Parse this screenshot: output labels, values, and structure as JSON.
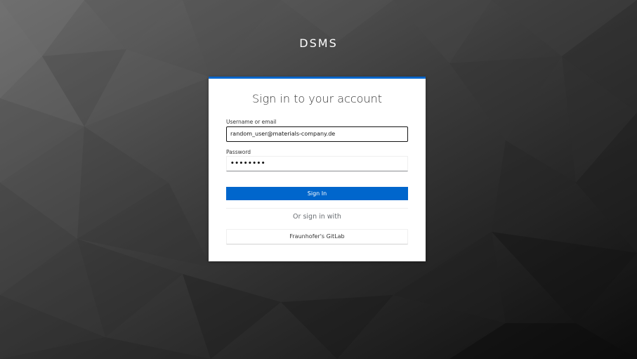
{
  "app": {
    "title": "DSMS"
  },
  "login": {
    "heading": "Sign in to your account",
    "username_label": "Username or email",
    "username_value": "random_user@materials-company.de",
    "password_label": "Password",
    "password_value": "••••••••",
    "signin_label": "Sign In",
    "alt_signin_text": "Or sign in with",
    "provider_label": "Fraunhofer's GitLab"
  },
  "colors": {
    "primary": "#0066cc",
    "card_bg": "#ffffff",
    "page_bg_dark": "#1a1a1a",
    "page_bg_light": "#5a5a5a"
  }
}
